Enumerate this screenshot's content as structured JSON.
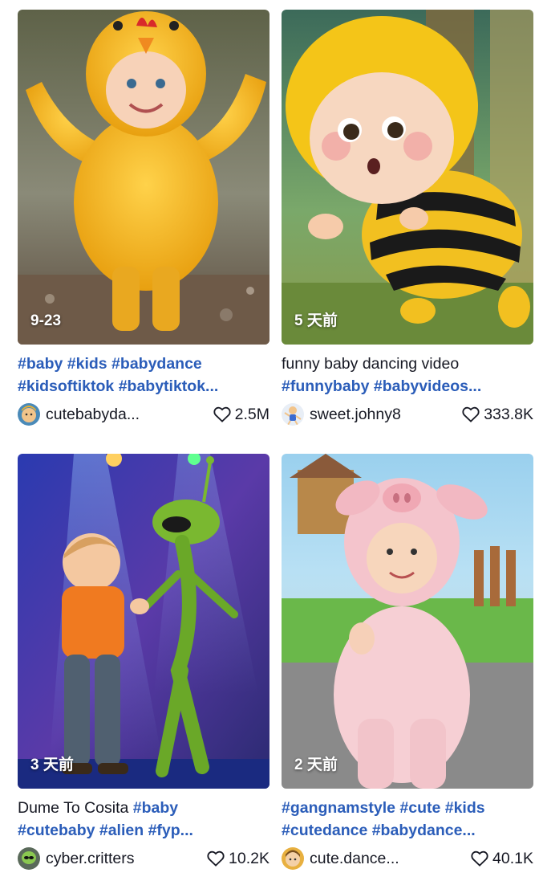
{
  "cards": [
    {
      "time": "9-23",
      "caption_line1": "#baby #kids #babydance",
      "caption_line2": "#kidsoftiktok #babytiktok...",
      "author": "cutebabyda...",
      "likes": "2.5M",
      "thumbnail_icon": "baby-chicken-costume-image",
      "avatar_icon": "baby-avatar"
    },
    {
      "time": "5 天前",
      "caption_line1": "funny baby dancing video",
      "caption_line2": "#funnybaby #babyvideos...",
      "author": "sweet.johny8",
      "likes": "333.8K",
      "thumbnail_icon": "baby-bee-costume-image",
      "avatar_icon": "dancing-baby-avatar"
    },
    {
      "time": "3 天前",
      "caption_plain": "Dume To Cosita ",
      "caption_line1": "#baby",
      "caption_line2": "#cutebaby #alien #fyp...",
      "author": "cyber.critters",
      "likes": "10.2K",
      "thumbnail_icon": "baby-and-alien-dancing-image",
      "avatar_icon": "alien-avatar"
    },
    {
      "time": "2 天前",
      "caption_line1": "#gangnamstyle #cute #kids",
      "caption_line2": "#cutedance #babydance...",
      "author": "cute.dance...",
      "likes": "40.1K",
      "thumbnail_icon": "baby-pig-costume-image",
      "avatar_icon": "baby-avatar"
    }
  ],
  "colors": {
    "hashtag": "#2b5db9",
    "text": "#161823",
    "badge_text": "#ffffff"
  }
}
